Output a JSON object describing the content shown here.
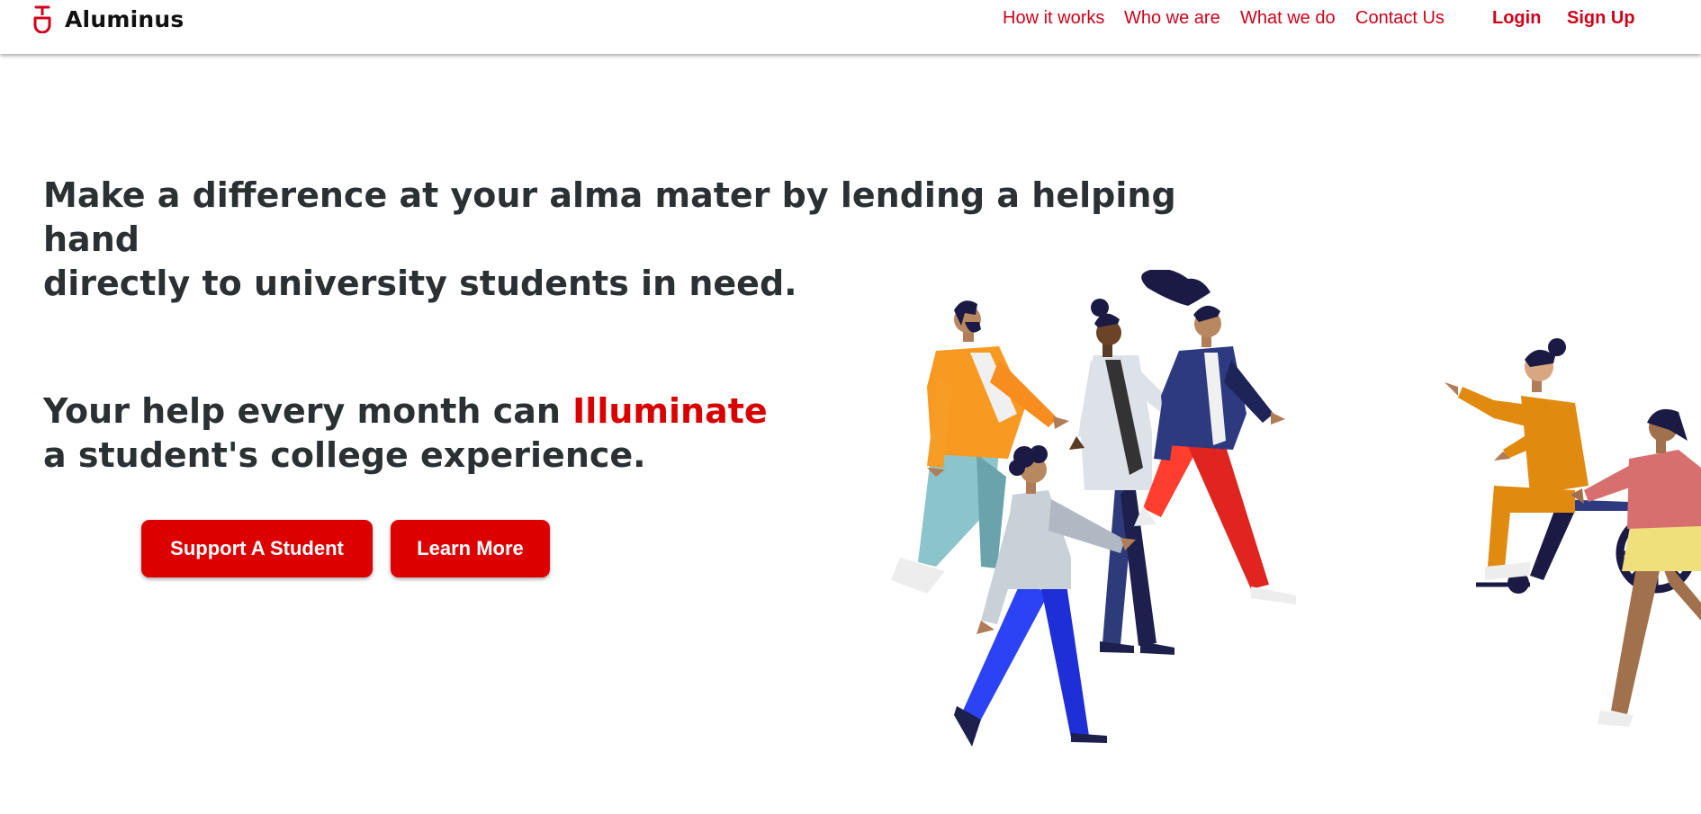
{
  "nav": {
    "brand_name": "Aluminus",
    "links": [
      "How it works",
      "Who we are",
      "What we do",
      "Contact Us"
    ],
    "login_label": "Login",
    "signup_label": "Sign Up"
  },
  "hero": {
    "title_line1": "Make a difference at your alma mater by lending a helping hand",
    "title_line2": "directly to university students in need.",
    "subtitle_before": "Your help every month can ",
    "subtitle_accent": "Illuminate",
    "subtitle_after": " a student's college experience.",
    "support_label": "Support A Student",
    "learn_label": "Learn More"
  },
  "colors": {
    "accent": "#d0021b",
    "button": "#dd0000",
    "heading": "#2b3032"
  },
  "icons": {
    "logo": "alembic-flask-icon"
  }
}
